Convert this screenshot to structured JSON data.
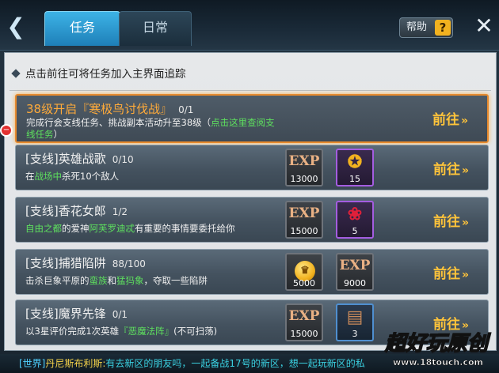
{
  "header": {
    "back_icon": "chevron-left-icon",
    "tabs": [
      {
        "label": "任务",
        "active": true
      },
      {
        "label": "日常",
        "active": false
      }
    ],
    "help_label": "帮助",
    "help_icon": "?",
    "close_icon": "close-icon"
  },
  "panel": {
    "hint": "点击前往可将任务加入主界面追踪",
    "go_label": "前往",
    "go_arrow": "»"
  },
  "quests": [
    {
      "title": "38级开启『寒极鸟讨伐战』",
      "progress": "0/1",
      "desc_parts": [
        {
          "text": "完成行会支线任务、挑战副本活动升至38级（",
          "green": false
        },
        {
          "text": "点击这里查阅支线任务",
          "green": true
        },
        {
          "text": "）",
          "green": false
        }
      ],
      "highlighted": true,
      "rewards": []
    },
    {
      "title": "[支线]英雄战歌",
      "progress": "0/10",
      "desc_parts": [
        {
          "text": "在",
          "green": false
        },
        {
          "text": "战场中",
          "green": true
        },
        {
          "text": "杀死10个敌人",
          "green": false
        }
      ],
      "rewards": [
        {
          "type": "exp",
          "icon": "EXP",
          "amount": "13000"
        },
        {
          "type": "purple",
          "icon": "gold-medal-icon",
          "glyph": "✪",
          "amount": "15"
        }
      ]
    },
    {
      "title": "[支线]香花女郎",
      "progress": "1/2",
      "desc_parts": [
        {
          "text": "自由之都",
          "green": true
        },
        {
          "text": "的爱神",
          "green": false
        },
        {
          "text": "阿芙罗迪忒",
          "green": true
        },
        {
          "text": "有重要的事情要委托给你",
          "green": false
        }
      ],
      "rewards": [
        {
          "type": "exp",
          "icon": "EXP",
          "amount": "15000"
        },
        {
          "type": "purple",
          "icon": "red-rose-icon",
          "glyph": "❀",
          "amount": "5"
        }
      ]
    },
    {
      "title": "[支线]捕猎陷阱",
      "progress": "88/100",
      "desc_parts": [
        {
          "text": "击杀巨象平原的",
          "green": false
        },
        {
          "text": "蛮族",
          "green": true
        },
        {
          "text": "和",
          "green": false
        },
        {
          "text": "猛犸象",
          "green": true
        },
        {
          "text": "，夺取一些陷阱",
          "green": false
        }
      ],
      "rewards": [
        {
          "type": "exp",
          "icon": "gold-coin-icon",
          "glyph": "♛",
          "amount": "5000"
        },
        {
          "type": "exp",
          "icon": "EXP",
          "amount": "9000"
        }
      ]
    },
    {
      "title": "[支线]魔界先锋",
      "progress": "0/1",
      "desc_parts": [
        {
          "text": "以3星评价完成1次英雄",
          "green": false
        },
        {
          "text": "『恶魔法阵』",
          "green": true
        },
        {
          "text": "(不可扫荡)",
          "green": false
        }
      ],
      "rewards": [
        {
          "type": "exp",
          "icon": "EXP",
          "amount": "15000"
        },
        {
          "type": "blue",
          "icon": "scroll-book-icon",
          "glyph": "▤",
          "amount": "3"
        }
      ]
    }
  ],
  "chat": {
    "channel": "[世界]",
    "name": "丹尼斯布利斯:",
    "message": "有去新区的朋友吗，一起备战17号的新区，想一起玩新区的私"
  },
  "watermark": {
    "logo": "超好玩原创",
    "url": "www.18touch.com"
  }
}
